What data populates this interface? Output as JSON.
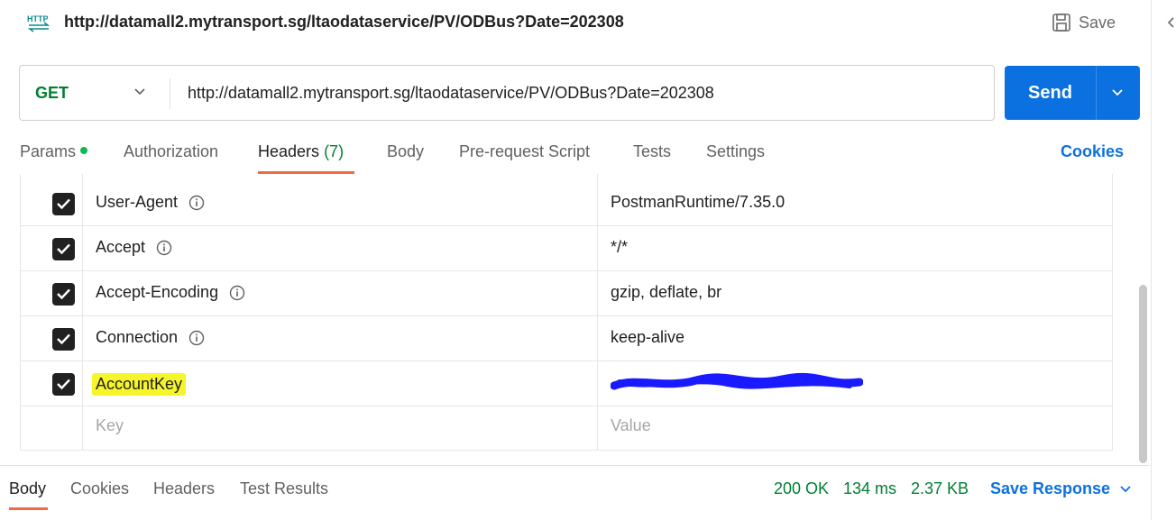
{
  "request": {
    "title": "http://datamall2.mytransport.sg/ltaodataservice/PV/ODBus?Date=202308",
    "save_label": "Save",
    "method": "GET",
    "url": "http://datamall2.mytransport.sg/ltaodataservice/PV/ODBus?Date=202308",
    "send_label": "Send"
  },
  "tabs": {
    "params": "Params",
    "authorization": "Authorization",
    "headers": "Headers",
    "headers_count": "(7)",
    "body": "Body",
    "prerequest": "Pre-request Script",
    "tests": "Tests",
    "settings": "Settings",
    "cookies": "Cookies"
  },
  "headers": [
    {
      "key": "User-Agent",
      "value": "PostmanRuntime/7.35.0"
    },
    {
      "key": "Accept",
      "value": "*/*"
    },
    {
      "key": "Accept-Encoding",
      "value": "gzip, deflate, br"
    },
    {
      "key": "Connection",
      "value": "keep-alive"
    },
    {
      "key": "AccountKey",
      "value": ""
    }
  ],
  "new_header": {
    "key_placeholder": "Key",
    "value_placeholder": "Value"
  },
  "response": {
    "tabs": {
      "body": "Body",
      "cookies": "Cookies",
      "headers": "Headers",
      "test_results": "Test Results"
    },
    "status": "200 OK",
    "time": "134 ms",
    "size": "2.37 KB",
    "save_response": "Save Response"
  },
  "colors": {
    "accent": "#0c71e0",
    "method_get": "#007f31",
    "tab_underline": "#f26b3a",
    "highlight": "#f6f42a",
    "redaction": "#1a1aff"
  }
}
